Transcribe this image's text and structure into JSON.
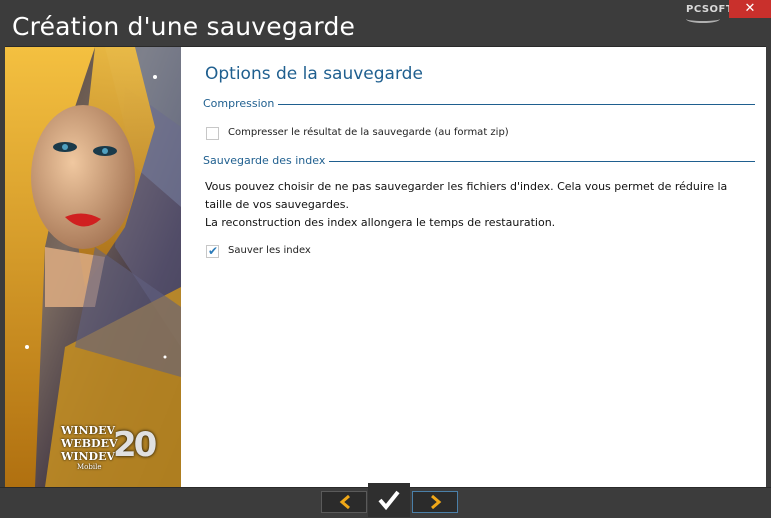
{
  "window": {
    "title": "Création d'une sauvegarde",
    "brand": "PCSOFT",
    "close_label": "✕"
  },
  "side_image": {
    "logo_lines": [
      "WINDEV",
      "WEBDEV",
      "WINDEV"
    ],
    "logo_mobile": "Mobile",
    "logo_version": "20"
  },
  "main": {
    "page_title": "Options de la sauvegarde",
    "sections": {
      "compression": {
        "label": "Compression",
        "checkbox_label": "Compresser le résultat de la sauvegarde (au format zip)",
        "checked": false
      },
      "index": {
        "label": "Sauvegarde des index",
        "description": [
          "Vous pouvez choisir de ne pas sauvegarder les fichiers d'index. Cela vous permet de réduire la",
          "taille de vos sauvegardes.",
          "La reconstruction des index allongera le temps de restauration."
        ],
        "checkbox_label": "Sauver les index",
        "checked": true
      }
    }
  },
  "footer": {
    "prev_icon": "chevron-left-icon",
    "validate_icon": "checkmark-icon",
    "next_icon": "chevron-right-icon"
  },
  "colors": {
    "titlebar": "#3c3c3c",
    "accent_blue": "#1f5f8f",
    "arrow_orange": "#f0a818",
    "close_red": "#c9302c"
  }
}
